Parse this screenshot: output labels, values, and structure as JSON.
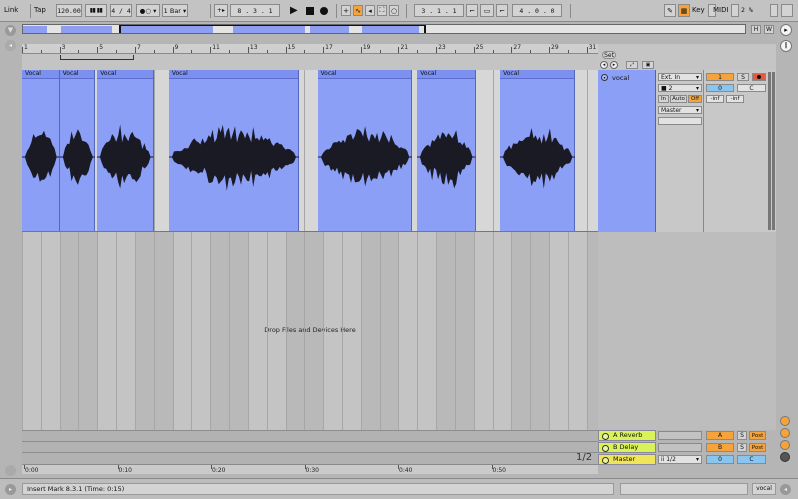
{
  "transport": {
    "link_label": "Link",
    "tap_label": "Tap",
    "tempo": "120.00",
    "time_signature": "4 / 4",
    "metronome_label": "●○",
    "quantize": "1 Bar",
    "position": "8 .  3 .  1",
    "loop_start": "3 .  1 .  1",
    "loop_length": "4 .  0 .  0",
    "key_label": "Key",
    "midi_label": "MIDI",
    "cpu_load": "2 %",
    "h_label": "H",
    "w_label": "W"
  },
  "overview_segments": [
    {
      "start": 0.0,
      "end": 0.033
    },
    {
      "start": 0.053,
      "end": 0.123
    },
    {
      "start": 0.134,
      "end": 0.263
    },
    {
      "start": 0.291,
      "end": 0.39
    },
    {
      "start": 0.398,
      "end": 0.452
    },
    {
      "start": 0.47,
      "end": 0.548
    }
  ],
  "ruler": {
    "bars": [
      1,
      3,
      5,
      7,
      9,
      11,
      13,
      15,
      17,
      19,
      21,
      23,
      25,
      27,
      29,
      31
    ],
    "labels": [
      "1",
      "3",
      "5",
      "7",
      "9",
      "11",
      "13",
      "15",
      "17",
      "19",
      "21",
      "23",
      "25",
      "27",
      "29",
      "31"
    ]
  },
  "set_label": "Set",
  "track": {
    "name": "vocal",
    "input_type": "Ext. In",
    "input_channel": "■ 2",
    "monitor_in": "In",
    "monitor_auto": "Auto",
    "monitor_off": "Off",
    "output": "Master",
    "track_number": "1",
    "solo": "S",
    "volume": "0",
    "pan": "C",
    "meter_left": "-inf",
    "meter_right": "-inf"
  },
  "clips": [
    {
      "name": "Vocal",
      "start_bar": 1.0,
      "end_bar": 3.0,
      "wave": "a"
    },
    {
      "name": "Vocal",
      "start_bar": 3.0,
      "end_bar": 4.9,
      "wave": "b"
    },
    {
      "name": "Vocal",
      "start_bar": 5.0,
      "end_bar": 8.0,
      "wave": "c"
    },
    {
      "name": "Vocal",
      "start_bar": 8.8,
      "end_bar": 15.7,
      "wave": "d"
    },
    {
      "name": "Vocal",
      "start_bar": 16.7,
      "end_bar": 21.7,
      "wave": "e"
    },
    {
      "name": "Vocal",
      "start_bar": 22.0,
      "end_bar": 25.1,
      "wave": "f"
    },
    {
      "name": "Vocal",
      "start_bar": 26.4,
      "end_bar": 30.4,
      "wave": "g"
    }
  ],
  "drop_message": "Drop Files and Devices Here",
  "returns": [
    {
      "name": "A Reverb",
      "letter": "A",
      "solo": "S",
      "post": "Post"
    },
    {
      "name": "B Delay",
      "letter": "B",
      "solo": "S",
      "post": "Post"
    }
  ],
  "master": {
    "name": "Master",
    "cue_out": "ii 1/2",
    "volume": "0",
    "pan": "C"
  },
  "page_indicator": "1/2",
  "time_ruler": [
    "0:00",
    "0:10",
    "0:20",
    "0:30",
    "0:40",
    "0:50"
  ],
  "status": {
    "message": "Insert Mark 8.3.1 (Time: 0:15)",
    "track_label": "vocal"
  },
  "colors": {
    "clip": "#8c9ff7",
    "clip_header": "#7c90f0",
    "return_track": "#d9f25a",
    "accent_orange": "#f5a33a",
    "accent_blue": "#8ac5ef",
    "record_red": "#e45a3a"
  }
}
